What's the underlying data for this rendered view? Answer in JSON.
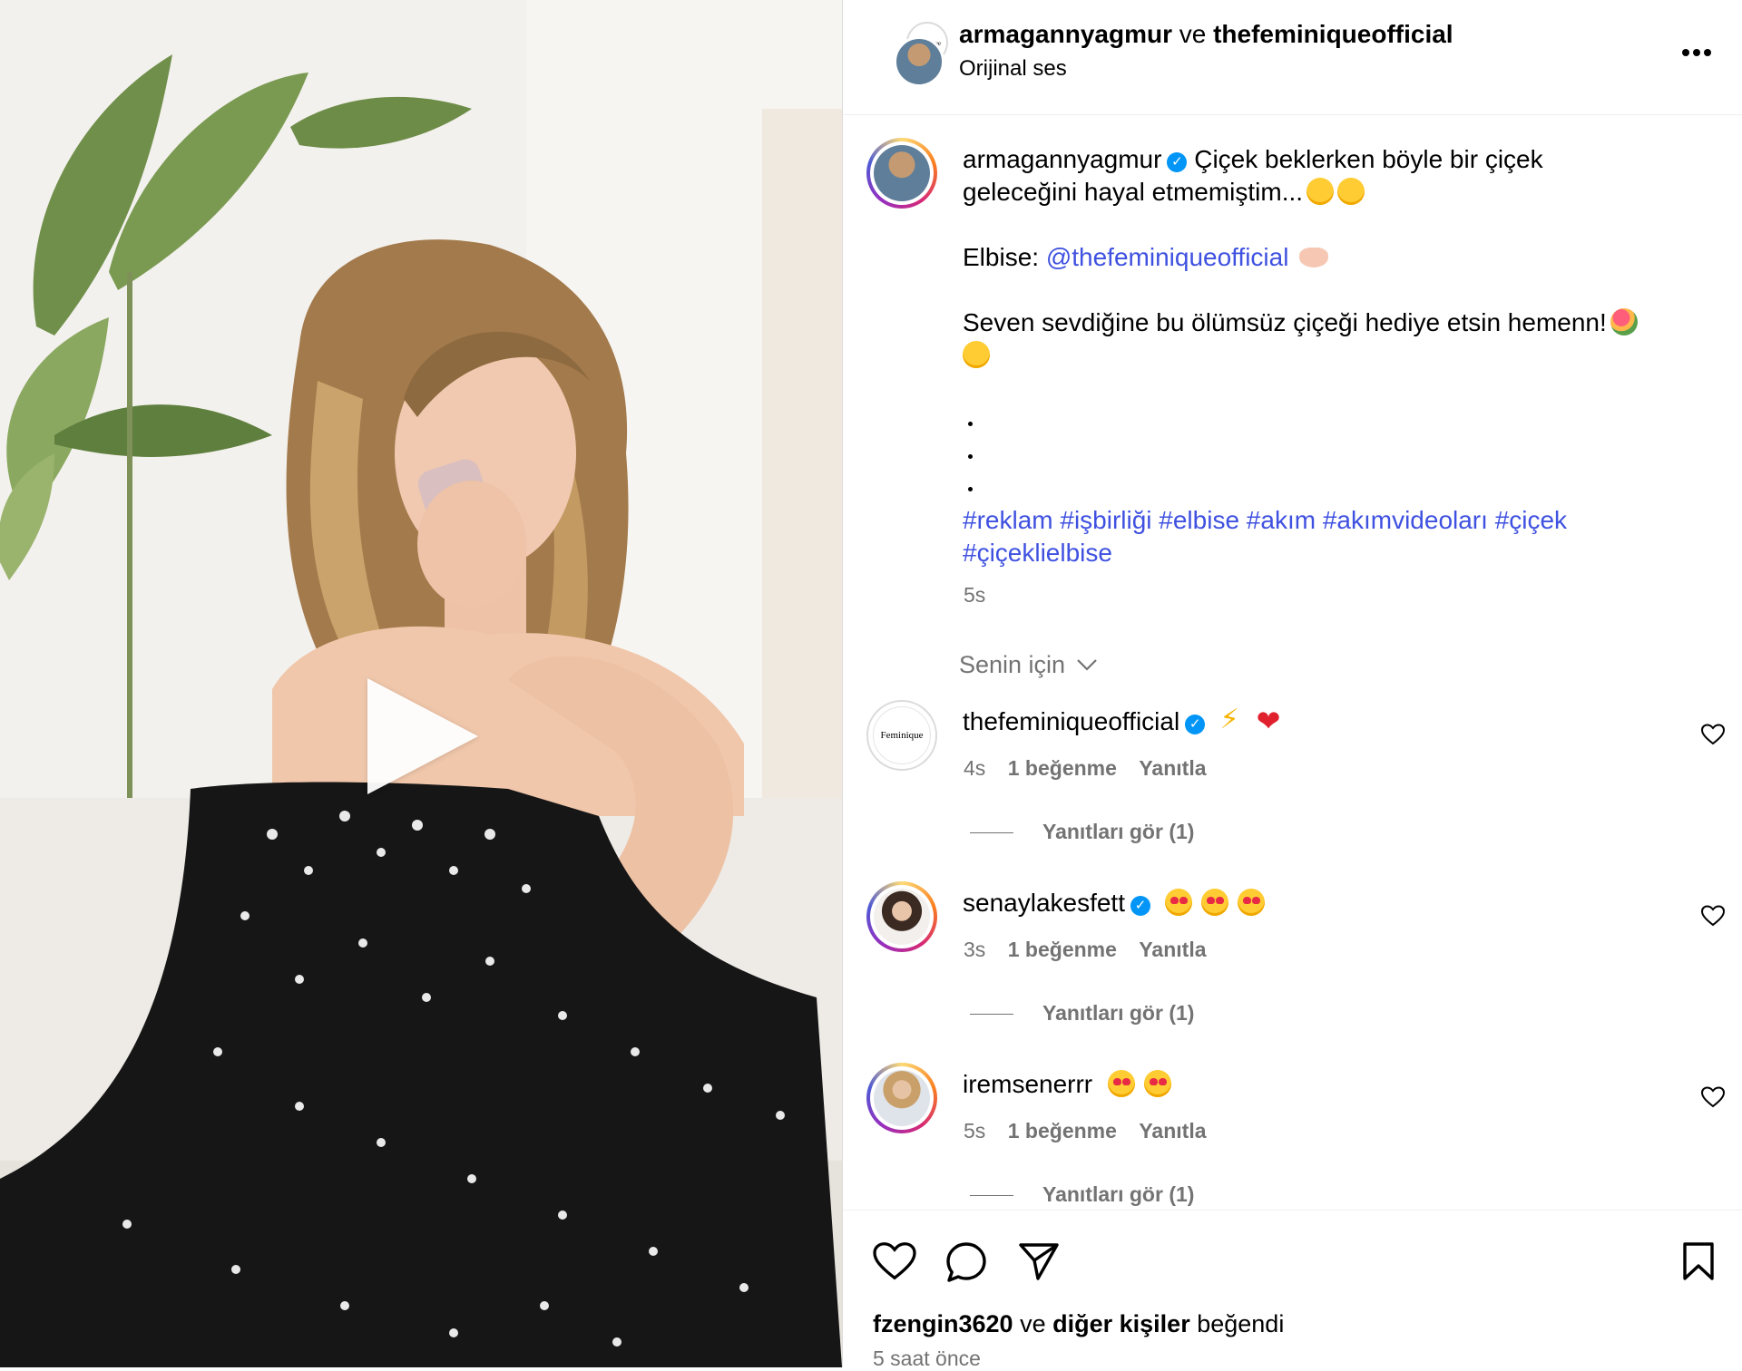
{
  "header": {
    "author": "armagannyagmur",
    "conjunction": "ve",
    "collaborator": "thefeminiqueofficial",
    "audio": "Orijinal ses",
    "more_icon": "more-horizontal-icon"
  },
  "caption": {
    "username": "armagannyagmur",
    "line1": "Çiçek beklerken böyle bir çiçek",
    "line2": "geleceğini hayal etmemiştim...",
    "elbise_label": "Elbise:",
    "mention": "@thefeminiqueofficial",
    "line3": "Seven sevdiğine bu ölümsüz çiçeği hediye etsin hemenn!",
    "hashtags_line1": "#reklam #işbirliği #elbise #akım #akımvideoları #çiçek",
    "hashtags_line2": "#çiçeklielbise",
    "time": "5s"
  },
  "filter": {
    "label": "Senin için"
  },
  "comments": [
    {
      "username": "thefeminiqueofficial",
      "avatar_text": "Feminique",
      "time": "4s",
      "likes": "1 beğenme",
      "reply": "Yanıtla",
      "view_replies": "Yanıtları gör (1)"
    },
    {
      "username": "senaylakesfett",
      "time": "3s",
      "likes": "1 beğenme",
      "reply": "Yanıtla",
      "view_replies": "Yanıtları gör (1)"
    },
    {
      "username": "iremsenerrr",
      "time": "5s",
      "likes": "1 beğenme",
      "reply": "Yanıtla",
      "view_replies": "Yanıtları gör (1)"
    }
  ],
  "footer": {
    "liked_by_user": "fzengin3620",
    "liked_by_conj": "ve",
    "liked_by_others": "diğer kişiler",
    "liked_by_suffix": "beğendi",
    "timestamp": "5 saat önce"
  },
  "colors": {
    "link": "#3f51e0",
    "verified": "#0095f6",
    "meta": "#737373"
  }
}
